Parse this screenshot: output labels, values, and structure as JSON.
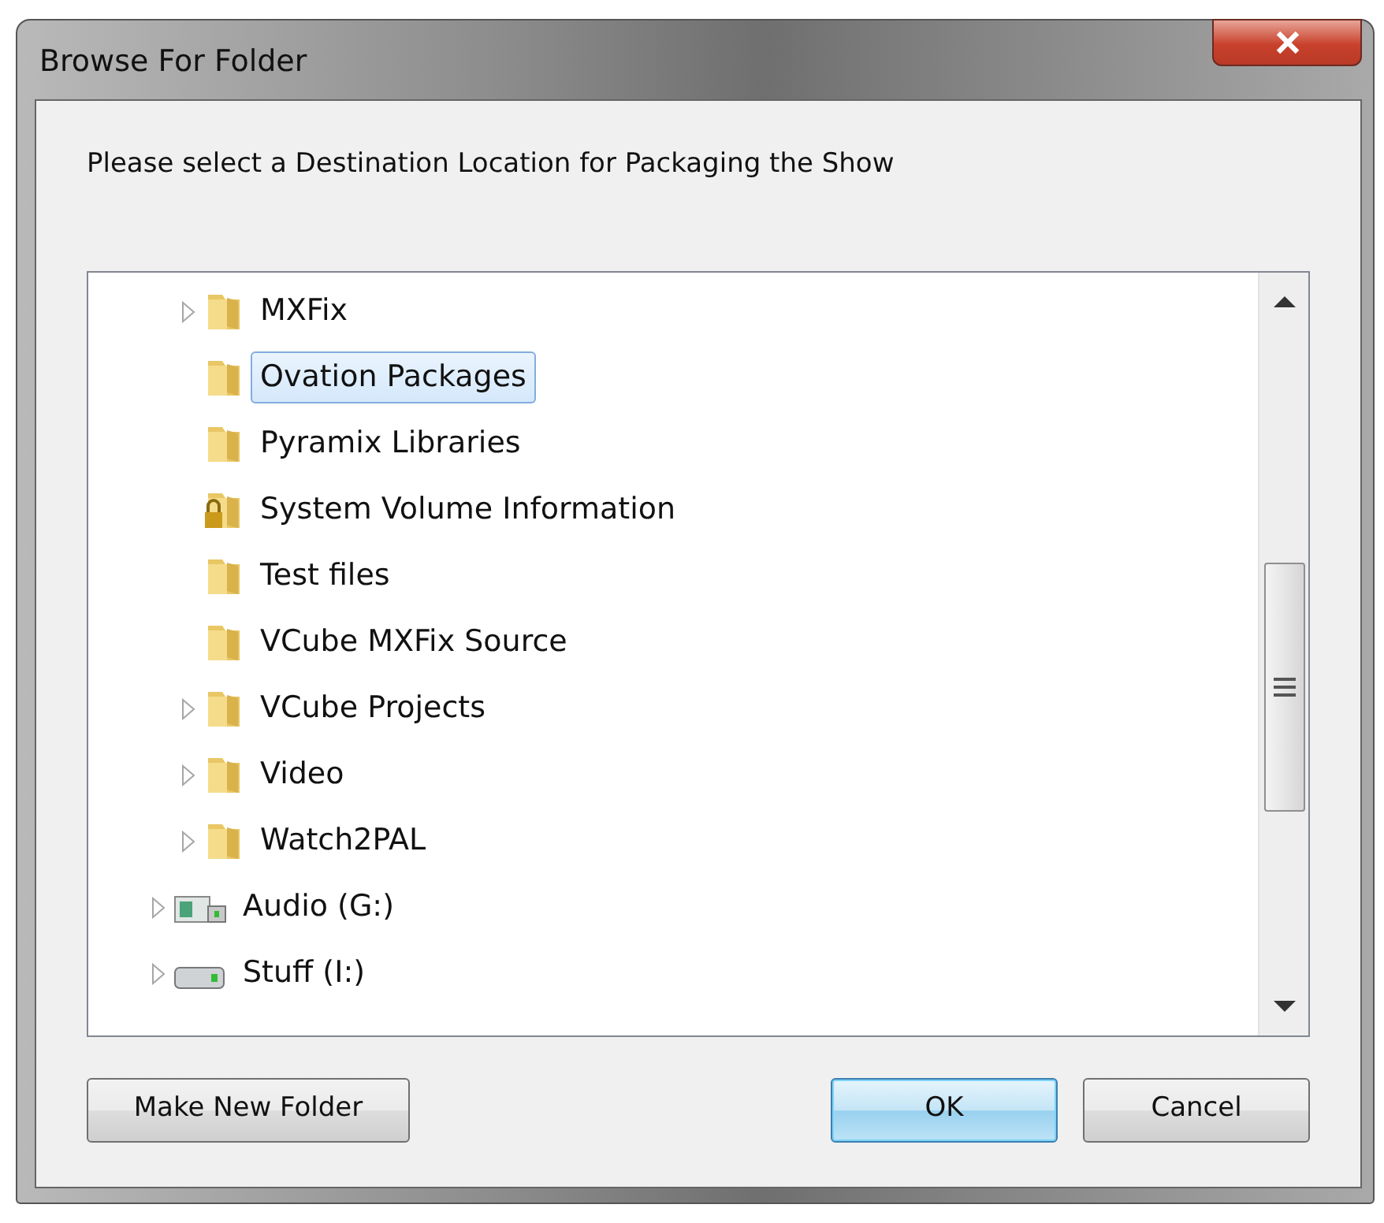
{
  "window": {
    "title": "Browse For Folder"
  },
  "prompt": "Please select a Destination Location for Packaging the Show",
  "tree": {
    "items": [
      {
        "children": [
          {
            "label": "MXFix",
            "kind": "folder",
            "expandable": true,
            "selected": false
          },
          {
            "label": "Ovation Packages",
            "kind": "folder",
            "expandable": false,
            "selected": true
          },
          {
            "label": "Pyramix Libraries",
            "kind": "folder",
            "expandable": false,
            "selected": false
          },
          {
            "label": "System Volume Information",
            "kind": "locked-folder",
            "expandable": false,
            "selected": false
          },
          {
            "label": "Test files",
            "kind": "folder",
            "expandable": false,
            "selected": false
          },
          {
            "label": "VCube MXFix Source",
            "kind": "folder",
            "expandable": false,
            "selected": false
          },
          {
            "label": "VCube Projects",
            "kind": "folder",
            "expandable": true,
            "selected": false
          },
          {
            "label": "Video",
            "kind": "folder",
            "expandable": true,
            "selected": false
          },
          {
            "label": "Watch2PAL",
            "kind": "folder",
            "expandable": true,
            "selected": false
          }
        ]
      },
      {
        "label": "Audio (G:)",
        "kind": "media-drive",
        "expandable": true,
        "selected": false
      },
      {
        "label": "Stuff (I:)",
        "kind": "drive",
        "expandable": true,
        "selected": false
      }
    ]
  },
  "buttons": [
    {
      "label": "Make New Folder",
      "default": false
    },
    {
      "label": "OK",
      "default": true
    },
    {
      "label": "Cancel",
      "default": false
    }
  ]
}
